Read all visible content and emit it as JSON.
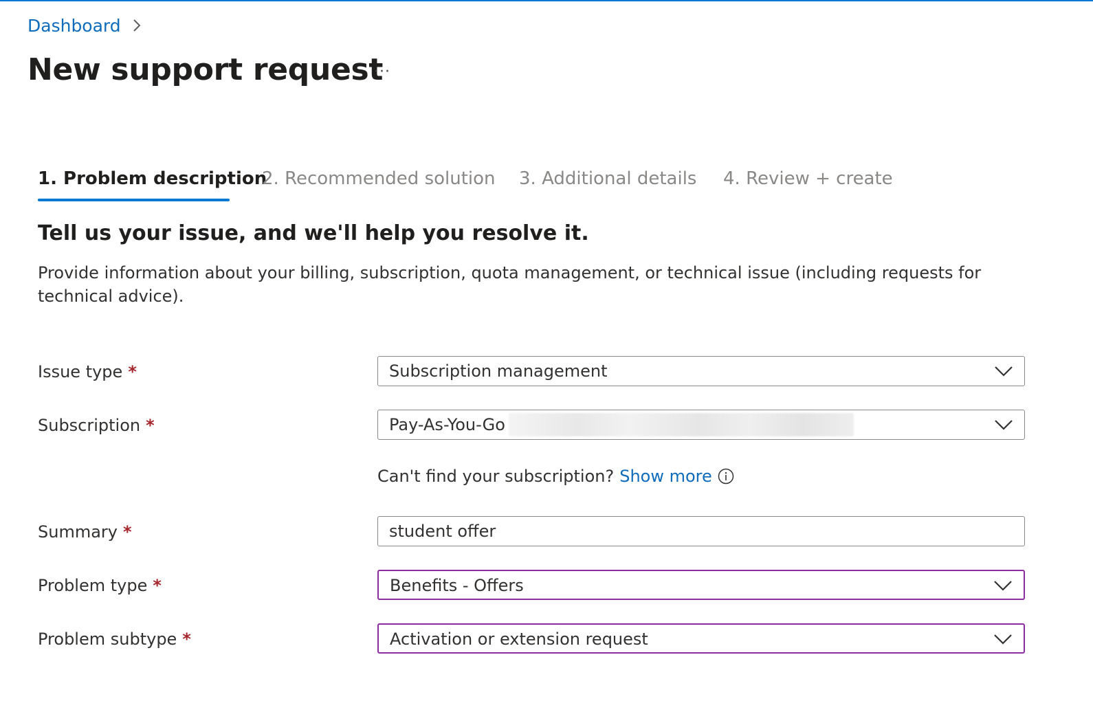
{
  "breadcrumb": {
    "items": [
      {
        "label": "Dashboard"
      }
    ]
  },
  "page": {
    "title": "New support request",
    "more_label": "···"
  },
  "tabs": [
    {
      "label": "1. Problem description",
      "active": true
    },
    {
      "label": "2. Recommended solution",
      "active": false
    },
    {
      "label": "3. Additional details",
      "active": false
    },
    {
      "label": "4. Review + create",
      "active": false
    }
  ],
  "section": {
    "heading": "Tell us your issue, and we'll help you resolve it.",
    "description": "Provide information about your billing, subscription, quota management, or technical issue (including requests for technical advice)."
  },
  "form": {
    "required_marker": "*",
    "issue_type": {
      "label": "Issue type",
      "value": "Subscription management"
    },
    "subscription": {
      "label": "Subscription",
      "value": "Pay-As-You-Go"
    },
    "subscription_help": {
      "text": "Can't find your subscription?",
      "link": "Show more"
    },
    "summary": {
      "label": "Summary",
      "value": "student offer"
    },
    "problem_type": {
      "label": "Problem type",
      "value": "Benefits - Offers"
    },
    "problem_subtype": {
      "label": "Problem subtype",
      "value": "Activation or extension request"
    }
  },
  "colors": {
    "accent": "#0078d4",
    "link": "#0f6cbd",
    "required": "#a4262c",
    "focus_border": "#8a2da5"
  }
}
